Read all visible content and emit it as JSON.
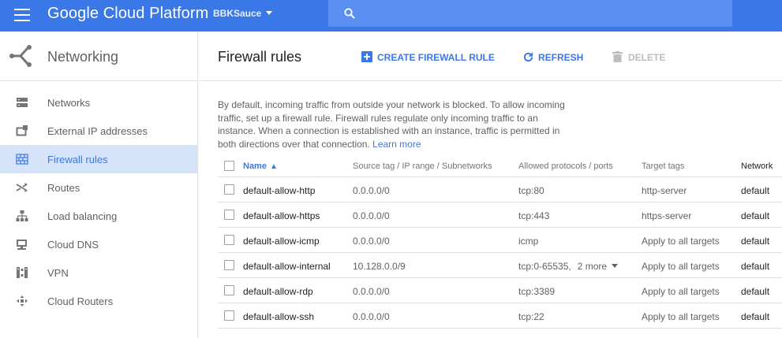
{
  "topbar": {
    "title": "Google Cloud Platform",
    "project": "BBKSauce",
    "search_placeholder": ""
  },
  "sidebar": {
    "title": "Networking",
    "items": [
      {
        "label": "Networks",
        "icon": "networks-icon"
      },
      {
        "label": "External IP addresses",
        "icon": "external-ip-icon"
      },
      {
        "label": "Firewall rules",
        "icon": "firewall-icon",
        "active": true
      },
      {
        "label": "Routes",
        "icon": "routes-icon"
      },
      {
        "label": "Load balancing",
        "icon": "load-balancing-icon"
      },
      {
        "label": "Cloud DNS",
        "icon": "dns-icon"
      },
      {
        "label": "VPN",
        "icon": "vpn-icon"
      },
      {
        "label": "Cloud Routers",
        "icon": "routers-icon"
      }
    ]
  },
  "main": {
    "title": "Firewall rules",
    "toolbar": {
      "create_label": "CREATE FIREWALL RULE",
      "refresh_label": "REFRESH",
      "delete_label": "DELETE"
    },
    "info_text": "By default, incoming traffic from outside your network is blocked. To allow incoming traffic, set up a firewall rule. Firewall rules regulate only incoming traffic to an instance. When a connection is established with an instance, traffic is permitted in both directions over that connection.",
    "learn_more": "Learn more"
  },
  "table": {
    "headers": {
      "name": "Name",
      "source": "Source tag / IP range / Subnetworks",
      "protocols": "Allowed protocols / ports",
      "tags": "Target tags",
      "network": "Network"
    },
    "rows": [
      {
        "name": "default-allow-http",
        "source": "0.0.0.0/0",
        "protocols": "tcp:80",
        "more": "",
        "tags": "http-server",
        "network": "default"
      },
      {
        "name": "default-allow-https",
        "source": "0.0.0.0/0",
        "protocols": "tcp:443",
        "more": "",
        "tags": "https-server",
        "network": "default"
      },
      {
        "name": "default-allow-icmp",
        "source": "0.0.0.0/0",
        "protocols": "icmp",
        "more": "",
        "tags": "Apply to all targets",
        "network": "default"
      },
      {
        "name": "default-allow-internal",
        "source": "10.128.0.0/9",
        "protocols": "tcp:0-65535,",
        "more": "2 more",
        "tags": "Apply to all targets",
        "network": "default"
      },
      {
        "name": "default-allow-rdp",
        "source": "0.0.0.0/0",
        "protocols": "tcp:3389",
        "more": "",
        "tags": "Apply to all targets",
        "network": "default"
      },
      {
        "name": "default-allow-ssh",
        "source": "0.0.0.0/0",
        "protocols": "tcp:22",
        "more": "",
        "tags": "Apply to all targets",
        "network": "default"
      }
    ]
  },
  "colors": {
    "brand_blue": "#3b78e7",
    "active_bg": "#d6e4f9",
    "text_gray": "#616161"
  }
}
